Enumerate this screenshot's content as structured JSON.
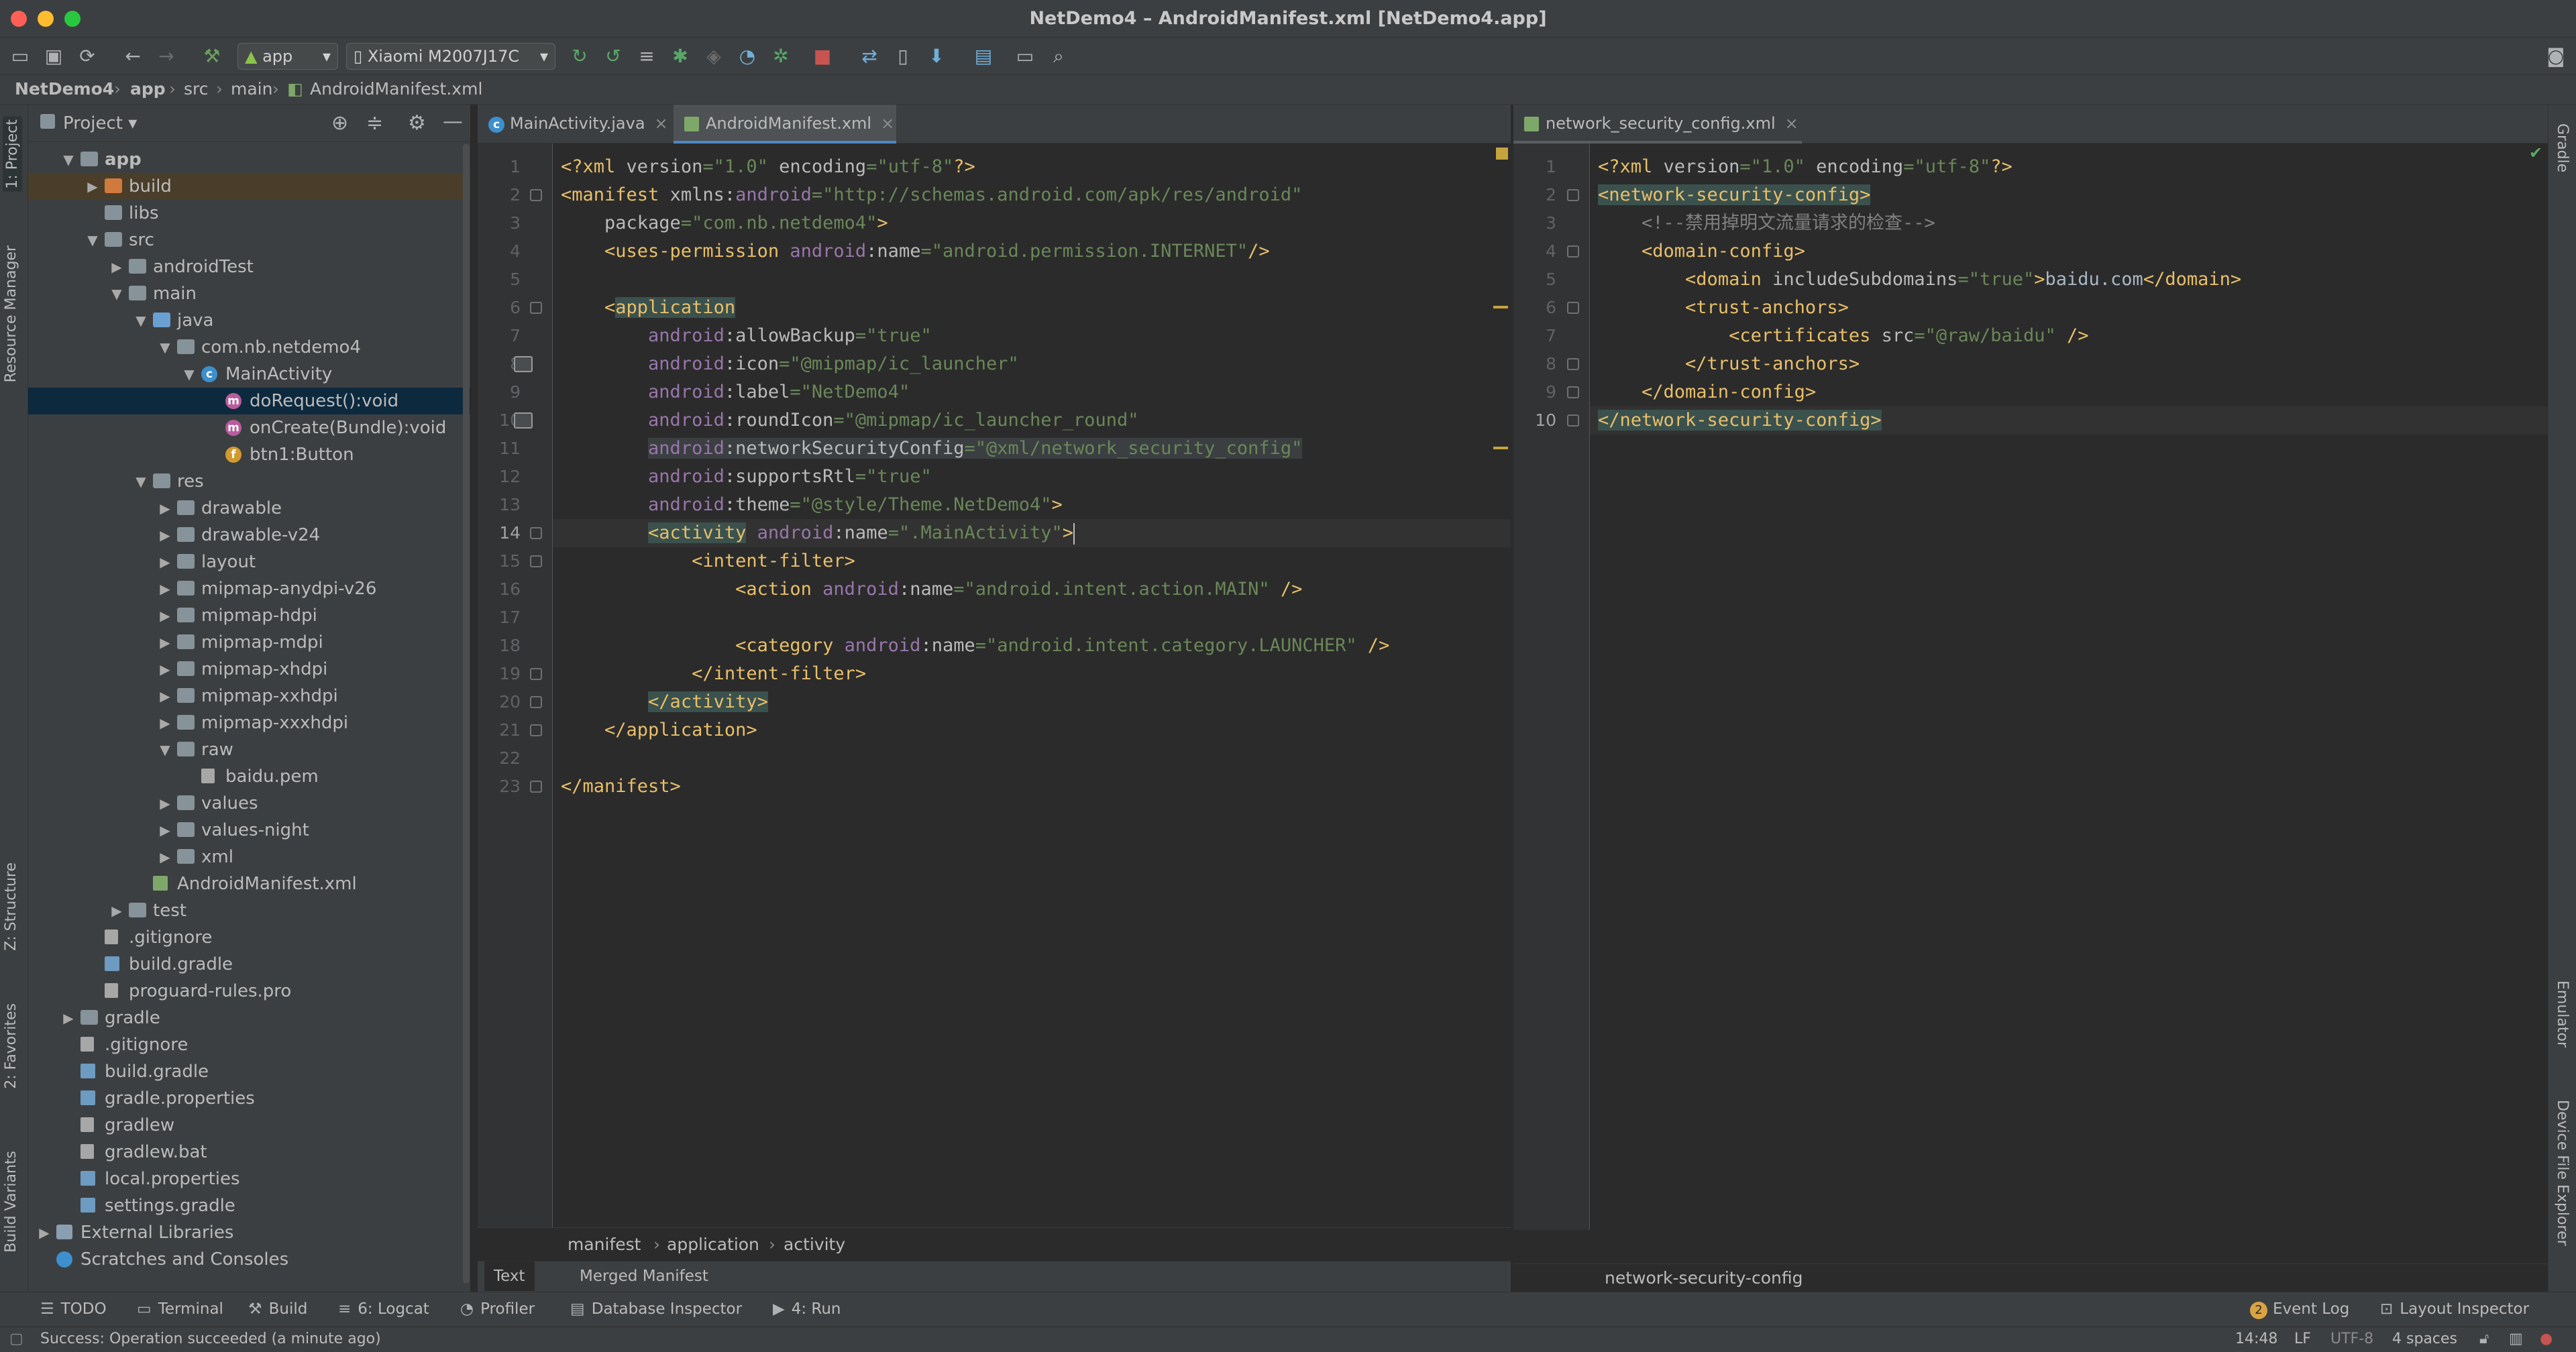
{
  "window": {
    "title": "NetDemo4 – AndroidManifest.xml [NetDemo4.app]"
  },
  "toolbar": {
    "config": "app",
    "device": "Xiaomi M2007J17C"
  },
  "breadcrumb": [
    "NetDemo4",
    "app",
    "src",
    "main",
    "AndroidManifest.xml"
  ],
  "left_tool_windows": [
    "1: Project",
    "Resource Manager",
    "Z: Structure",
    "2: Favorites",
    "Build Variants"
  ],
  "right_tool_windows": [
    "Gradle",
    "Emulator",
    "Device File Explorer"
  ],
  "project": {
    "view_label": "Project",
    "tree": [
      {
        "label": "app",
        "level": 0,
        "open": "open",
        "kind": "module",
        "bold": true
      },
      {
        "label": "build",
        "level": 1,
        "open": "closed",
        "kind": "folder-excl",
        "highlight": true
      },
      {
        "label": "libs",
        "level": 1,
        "open": "",
        "kind": "folder"
      },
      {
        "label": "src",
        "level": 1,
        "open": "open",
        "kind": "folder"
      },
      {
        "label": "androidTest",
        "level": 2,
        "open": "closed",
        "kind": "folder"
      },
      {
        "label": "main",
        "level": 2,
        "open": "open",
        "kind": "folder"
      },
      {
        "label": "java",
        "level": 3,
        "open": "open",
        "kind": "folder-src"
      },
      {
        "label": "com.nb.netdemo4",
        "level": 4,
        "open": "open",
        "kind": "folder"
      },
      {
        "label": "MainActivity",
        "level": 5,
        "open": "open",
        "kind": "class"
      },
      {
        "label": "doRequest():void",
        "level": 6,
        "open": "",
        "kind": "method",
        "selected": true
      },
      {
        "label": "onCreate(Bundle):void",
        "level": 6,
        "open": "",
        "kind": "method"
      },
      {
        "label": "btn1:Button",
        "level": 6,
        "open": "",
        "kind": "field"
      },
      {
        "label": "res",
        "level": 3,
        "open": "open",
        "kind": "folder"
      },
      {
        "label": "drawable",
        "level": 4,
        "open": "closed",
        "kind": "folder"
      },
      {
        "label": "drawable-v24",
        "level": 4,
        "open": "closed",
        "kind": "folder"
      },
      {
        "label": "layout",
        "level": 4,
        "open": "closed",
        "kind": "folder"
      },
      {
        "label": "mipmap-anydpi-v26",
        "level": 4,
        "open": "closed",
        "kind": "folder"
      },
      {
        "label": "mipmap-hdpi",
        "level": 4,
        "open": "closed",
        "kind": "folder"
      },
      {
        "label": "mipmap-mdpi",
        "level": 4,
        "open": "closed",
        "kind": "folder"
      },
      {
        "label": "mipmap-xhdpi",
        "level": 4,
        "open": "closed",
        "kind": "folder"
      },
      {
        "label": "mipmap-xxhdpi",
        "level": 4,
        "open": "closed",
        "kind": "folder"
      },
      {
        "label": "mipmap-xxxhdpi",
        "level": 4,
        "open": "closed",
        "kind": "folder"
      },
      {
        "label": "raw",
        "level": 4,
        "open": "open",
        "kind": "folder"
      },
      {
        "label": "baidu.pem",
        "level": 5,
        "open": "",
        "kind": "file"
      },
      {
        "label": "values",
        "level": 4,
        "open": "closed",
        "kind": "folder"
      },
      {
        "label": "values-night",
        "level": 4,
        "open": "closed",
        "kind": "folder"
      },
      {
        "label": "xml",
        "level": 4,
        "open": "closed",
        "kind": "folder"
      },
      {
        "label": "AndroidManifest.xml",
        "level": 3,
        "open": "",
        "kind": "xml"
      },
      {
        "label": "test",
        "level": 2,
        "open": "closed",
        "kind": "folder"
      },
      {
        "label": ".gitignore",
        "level": 1,
        "open": "",
        "kind": "file"
      },
      {
        "label": "build.gradle",
        "level": 1,
        "open": "",
        "kind": "gradle"
      },
      {
        "label": "proguard-rules.pro",
        "level": 1,
        "open": "",
        "kind": "file"
      },
      {
        "label": "gradle",
        "level": 0,
        "open": "closed",
        "kind": "folder"
      },
      {
        "label": ".gitignore",
        "level": 0,
        "open": "",
        "kind": "file"
      },
      {
        "label": "build.gradle",
        "level": 0,
        "open": "",
        "kind": "gradle"
      },
      {
        "label": "gradle.properties",
        "level": 0,
        "open": "",
        "kind": "gradle"
      },
      {
        "label": "gradlew",
        "level": 0,
        "open": "",
        "kind": "file"
      },
      {
        "label": "gradlew.bat",
        "level": 0,
        "open": "",
        "kind": "file"
      },
      {
        "label": "local.properties",
        "level": 0,
        "open": "",
        "kind": "gradle"
      },
      {
        "label": "settings.gradle",
        "level": 0,
        "open": "",
        "kind": "gradle"
      },
      {
        "label": "External Libraries",
        "level": -1,
        "open": "closed",
        "kind": "lib"
      },
      {
        "label": "Scratches and Consoles",
        "level": -1,
        "open": "",
        "kind": "scratch"
      }
    ]
  },
  "editor_left": {
    "tabs": [
      {
        "label": "MainActivity.java",
        "kind": "class",
        "active": false
      },
      {
        "label": "AndroidManifest.xml",
        "kind": "xml",
        "active": true
      }
    ],
    "current_line": 14,
    "lines": [
      [
        [
          "c-tag",
          "<?xml "
        ],
        [
          "c-attr",
          "version"
        ],
        [
          "c-val",
          "=\"1.0\" "
        ],
        [
          "c-attr",
          "encoding"
        ],
        [
          "c-val",
          "=\"utf-8\""
        ],
        [
          "c-tag",
          "?>"
        ]
      ],
      [
        [
          "c-tag",
          "<manifest "
        ],
        [
          "c-attr",
          "xmlns:"
        ],
        [
          "c-ns",
          "android"
        ],
        [
          "c-val",
          "=\"http://schemas.android.com/apk/res/android\""
        ]
      ],
      [
        [
          "c-attr",
          "    package"
        ],
        [
          "c-val",
          "=\"com.nb.netdemo4\""
        ],
        [
          "c-tag",
          ">"
        ]
      ],
      [
        [
          "c-tag",
          "    <uses-permission "
        ],
        [
          "c-ns",
          "android"
        ],
        [
          "c-attr",
          ":name"
        ],
        [
          "c-val",
          "=\"android.permission.INTERNET\""
        ],
        [
          "c-tag",
          "/>"
        ]
      ],
      [],
      [
        [
          "c-tag",
          "    <"
        ],
        [
          "c-tag hl-tag",
          "application"
        ]
      ],
      [
        [
          "c-ns",
          "        android"
        ],
        [
          "c-attr",
          ":allowBackup"
        ],
        [
          "c-val",
          "=\"true\""
        ]
      ],
      [
        [
          "c-ns",
          "        android"
        ],
        [
          "c-attr",
          ":icon"
        ],
        [
          "c-val",
          "=\"@mipmap/ic_launcher\""
        ]
      ],
      [
        [
          "c-ns",
          "        android"
        ],
        [
          "c-attr",
          ":label"
        ],
        [
          "c-val",
          "=\"NetDemo4\""
        ]
      ],
      [
        [
          "c-ns",
          "        android"
        ],
        [
          "c-attr",
          ":roundIcon"
        ],
        [
          "c-val",
          "=\"@mipmap/ic_launcher_round\""
        ]
      ],
      [
        [
          "c-plain",
          "        "
        ],
        [
          "c-ns hl-ns",
          "android"
        ],
        [
          "c-attr hl-ns",
          ":networkSecurityConfig"
        ],
        [
          "c-val hl-ns",
          "=\"@xml/network_security_config\""
        ]
      ],
      [
        [
          "c-ns",
          "        android"
        ],
        [
          "c-attr",
          ":supportsRtl"
        ],
        [
          "c-val",
          "=\"true\""
        ]
      ],
      [
        [
          "c-ns",
          "        android"
        ],
        [
          "c-attr",
          ":theme"
        ],
        [
          "c-val",
          "=\"@style/Theme.NetDemo4\""
        ],
        [
          "c-tag",
          ">"
        ]
      ],
      [
        [
          "c-plain",
          "        "
        ],
        [
          "c-tag hl-tag",
          "<activity"
        ],
        [
          "c-tag",
          " "
        ],
        [
          "c-ns",
          "android"
        ],
        [
          "c-attr",
          ":name"
        ],
        [
          "c-val",
          "=\".MainActivity\""
        ],
        [
          "c-tag",
          ">"
        ]
      ],
      [
        [
          "c-tag",
          "            <intent-filter>"
        ]
      ],
      [
        [
          "c-tag",
          "                <action "
        ],
        [
          "c-ns",
          "android"
        ],
        [
          "c-attr",
          ":name"
        ],
        [
          "c-val",
          "=\"android.intent.action.MAIN\""
        ],
        [
          "c-tag",
          " />"
        ]
      ],
      [],
      [
        [
          "c-tag",
          "                <category "
        ],
        [
          "c-ns",
          "android"
        ],
        [
          "c-attr",
          ":name"
        ],
        [
          "c-val",
          "=\"android.intent.category.LAUNCHER\""
        ],
        [
          "c-tag",
          " />"
        ]
      ],
      [
        [
          "c-tag",
          "            </intent-filter>"
        ]
      ],
      [
        [
          "c-plain",
          "        "
        ],
        [
          "c-tag hl-tag",
          "</activity>"
        ]
      ],
      [
        [
          "c-tag",
          "    </application>"
        ]
      ],
      [],
      [
        [
          "c-tag",
          "</manifest>"
        ]
      ]
    ],
    "crumbs": [
      "manifest",
      "application",
      "activity"
    ],
    "bottom_tabs": [
      "Text",
      "Merged Manifest"
    ]
  },
  "editor_right": {
    "tabs": [
      {
        "label": "network_security_config.xml",
        "kind": "xml",
        "active": true
      }
    ],
    "current_line": 10,
    "lines": [
      [
        [
          "c-tag",
          "<?xml "
        ],
        [
          "c-attr",
          "version"
        ],
        [
          "c-val",
          "=\"1.0\" "
        ],
        [
          "c-attr",
          "encoding"
        ],
        [
          "c-val",
          "=\"utf-8\""
        ],
        [
          "c-tag",
          "?>"
        ]
      ],
      [
        [
          "c-tag hl-tag",
          "<network-security-config>"
        ]
      ],
      [
        [
          "c-comment",
          "    <!--禁用掉明文流量请求的检查-->"
        ]
      ],
      [
        [
          "c-tag",
          "    <domain-config>"
        ]
      ],
      [
        [
          "c-tag",
          "        <domain "
        ],
        [
          "c-attr",
          "includeSubdomains"
        ],
        [
          "c-val",
          "=\"true\""
        ],
        [
          "c-tag",
          ">"
        ],
        [
          "c-plain",
          "baidu.com"
        ],
        [
          "c-tag",
          "</domain>"
        ]
      ],
      [
        [
          "c-tag",
          "        <trust-anchors>"
        ]
      ],
      [
        [
          "c-tag",
          "            <certificates "
        ],
        [
          "c-attr",
          "src"
        ],
        [
          "c-val",
          "=\"@raw/baidu\""
        ],
        [
          "c-tag",
          " />"
        ]
      ],
      [
        [
          "c-tag",
          "        </trust-anchors>"
        ]
      ],
      [
        [
          "c-tag",
          "    </domain-config>"
        ]
      ],
      [
        [
          "c-tag hl-tag",
          "</network-security-config>"
        ]
      ]
    ],
    "crumbs": [
      "network-security-config"
    ]
  },
  "bottom_tools": [
    {
      "label": "TODO",
      "icon": "list-icon"
    },
    {
      "label": "Terminal",
      "icon": "terminal-icon"
    },
    {
      "label": "Build",
      "icon": "hammer-icon"
    },
    {
      "label": "6: Logcat",
      "icon": "logcat-icon"
    },
    {
      "label": "Profiler",
      "icon": "gauge-icon"
    },
    {
      "label": "Database Inspector",
      "icon": "database-icon"
    },
    {
      "label": "4: Run",
      "icon": "play-icon"
    }
  ],
  "right_bottom_tools": [
    {
      "label": "Event Log",
      "badge": "2"
    },
    {
      "label": "Layout Inspector"
    }
  ],
  "status": {
    "message": "Success: Operation succeeded (a minute ago)",
    "position": "14:48",
    "line_sep": "LF",
    "encoding": "UTF-8",
    "indent": "4 spaces"
  },
  "colors": {
    "accent": "#4a88c7",
    "tag": "#e8bf6a",
    "string": "#6a8759",
    "namespace": "#9876aa",
    "comment": "#808080"
  }
}
